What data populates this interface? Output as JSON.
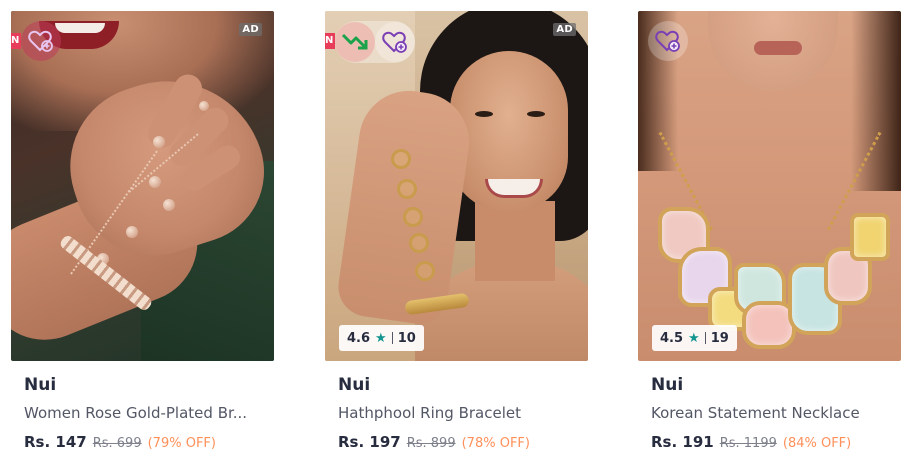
{
  "products": [
    {
      "brand": "Nui",
      "name": "Women Rose Gold-Plated Br...",
      "price": "Rs. 147",
      "mrp": "Rs. 699",
      "discount": "(79% OFF)",
      "ad_label": "AD",
      "rating": null,
      "rating_count": null
    },
    {
      "brand": "Nui",
      "name": "Hathphool Ring Bracelet",
      "price": "Rs. 197",
      "mrp": "Rs. 899",
      "discount": "(78% OFF)",
      "ad_label": "AD",
      "rating": "4.6",
      "rating_count": "10"
    },
    {
      "brand": "Nui",
      "name": "Korean Statement Necklace",
      "price": "Rs. 191",
      "mrp": "Rs. 1199",
      "discount": "(84% OFF)",
      "ad_label": null,
      "rating": "4.5",
      "rating_count": "19"
    }
  ],
  "icons": {
    "wishlist": "heart-plus-icon",
    "similar": "trend-down-icon",
    "star": "star-icon"
  },
  "colors": {
    "rating_star": "#14958f",
    "discount": "#ff905a",
    "similar_arrow": "#1aa34a",
    "new_tag": "#e83d5a"
  }
}
